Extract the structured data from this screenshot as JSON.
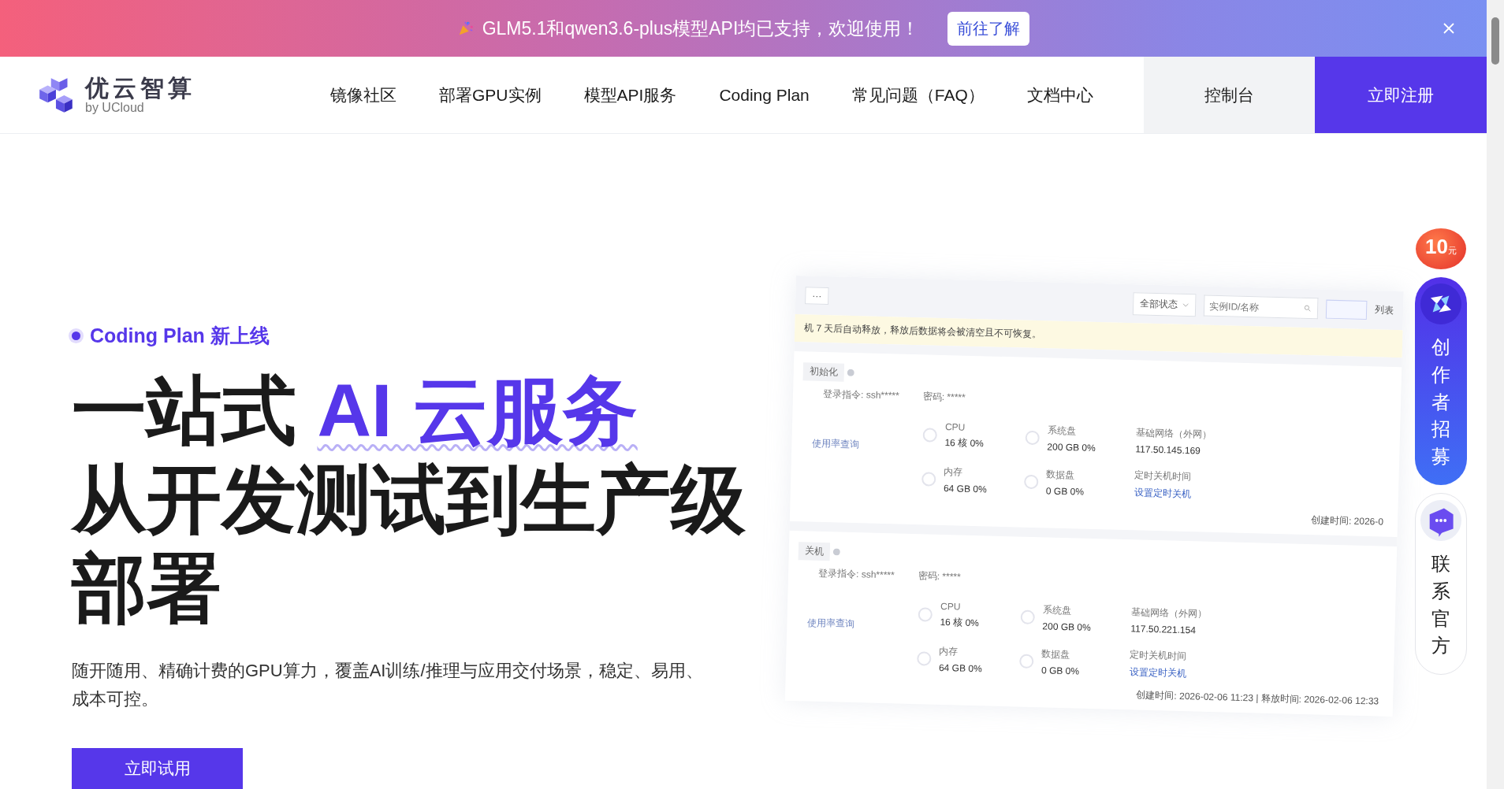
{
  "banner": {
    "text": "GLM5.1和qwen3.6-plus模型API均已支持，欢迎使用！",
    "button": "前往了解"
  },
  "nav": {
    "logo_title": "优云智算",
    "logo_subtitle": "by UCloud",
    "items": [
      {
        "label": "镜像社区"
      },
      {
        "label": "部署GPU实例"
      },
      {
        "label": "模型API服务"
      },
      {
        "label": "Coding Plan"
      },
      {
        "label": "常见问题（FAQ）"
      },
      {
        "label": "文档中心"
      }
    ],
    "console": "控制台",
    "signup": "立即注册"
  },
  "hero": {
    "badge": "Coding Plan 新上线",
    "headline_lines": [
      [
        {
          "text": "一站式 ",
          "accent": false
        },
        {
          "text": "AI 云服务",
          "accent": true
        }
      ],
      [
        {
          "text": "从开发测试到生产级",
          "accent": false
        }
      ],
      [
        {
          "text": "部署",
          "accent": false
        }
      ]
    ],
    "subtitle": "随开随用、精确计费的GPU算力，覆盖AI训练/推理与应用交付场景，稳定、易用、成本可控。",
    "cta": "立即试用"
  },
  "console_preview": {
    "more": "···",
    "status_filter": "全部状态",
    "search_placeholder": "实例ID/名称",
    "view": "列表",
    "notice": "机 7 天后自动释放，释放后数据将会被清空且不可恢复。",
    "instances": [
      {
        "status": "初始化",
        "login": "登录指令: ssh*****",
        "password": "密码: *****",
        "usage": "使用率查询",
        "metrics": [
          {
            "kind": "gauge",
            "label": "CPU",
            "value": "16 核 0%"
          },
          {
            "kind": "gauge",
            "label": "系统盘",
            "value": "200 GB 0%"
          },
          {
            "kind": "text",
            "label": "基础网络（外网）",
            "value": "117.50.145.169"
          },
          {
            "kind": "gauge",
            "label": "内存",
            "value": "64 GB 0%"
          },
          {
            "kind": "gauge",
            "label": "数据盘",
            "value": "0 GB 0%"
          },
          {
            "kind": "link",
            "label": "定时关机时间",
            "value": "设置定时关机"
          }
        ],
        "footer": "创建时间: 2026-0"
      },
      {
        "status": "关机",
        "login": "登录指令: ssh*****",
        "password": "密码: *****",
        "usage": "使用率查询",
        "metrics": [
          {
            "kind": "gauge",
            "label": "CPU",
            "value": "16 核 0%"
          },
          {
            "kind": "gauge",
            "label": "系统盘",
            "value": "200 GB 0%"
          },
          {
            "kind": "text",
            "label": "基础网络（外网）",
            "value": "117.50.221.154"
          },
          {
            "kind": "gauge",
            "label": "内存",
            "value": "64 GB 0%"
          },
          {
            "kind": "gauge",
            "label": "数据盘",
            "value": "0 GB 0%"
          },
          {
            "kind": "link",
            "label": "定时关机时间",
            "value": "设置定时关机"
          }
        ],
        "footer": "创建时间: 2026-02-06 11:23  |  释放时间: 2026-02-06 12:33"
      }
    ]
  },
  "floating": {
    "coupon_amount": "10",
    "coupon_unit": "元",
    "recruit": "创作者招募",
    "contact": "联系官方"
  }
}
